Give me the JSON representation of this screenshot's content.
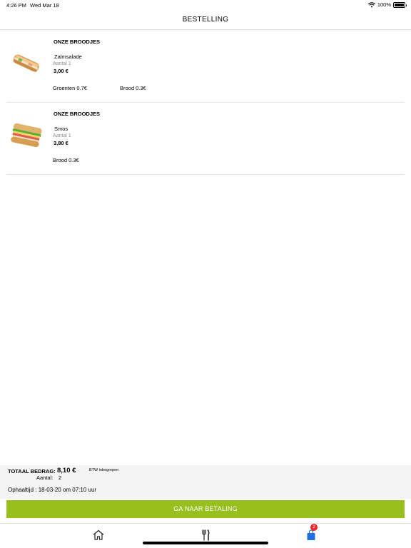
{
  "status_bar": {
    "time": "4:26 PM",
    "date": "Wed Mar 18",
    "battery": "100%",
    "battery_level": 1.0,
    "icons": [
      "wifi-icon",
      "battery-icon"
    ]
  },
  "header": {
    "title": "BESTELLING"
  },
  "items": [
    {
      "category": "ONZE BROODJES",
      "name": "Zalmsalade",
      "qty": "Aantal 1",
      "price": "3,00 €",
      "extras": [
        "Groenten  0.7€",
        "Brood  0.3€"
      ],
      "image": "salmon-baguette-image"
    },
    {
      "category": "ONZE BROODJES",
      "name": "Smos",
      "qty": "Aantal 1",
      "price": "3,80 €",
      "extras": [
        "Brood  0.3€"
      ],
      "image": "smos-sandwich-image"
    }
  ],
  "summary": {
    "total_label": "TOTAAL BEDRAG:",
    "total_value": "8,10 €",
    "vat_note": "BTW inbegrepen",
    "count_label": "Aantal:",
    "count_value": "2",
    "pickup": "Ophaaltijd : 18-03-20 om 07:10 uur"
  },
  "pay_button": {
    "label": "GA NAAR BETALING"
  },
  "tab_bar": {
    "tabs": [
      {
        "name": "home",
        "icon": "home-icon"
      },
      {
        "name": "menu",
        "icon": "fork-knife-icon"
      },
      {
        "name": "cart",
        "icon": "shopping-bag-icon",
        "badge": "2"
      }
    ]
  },
  "colors": {
    "accent": "#97c01e",
    "badge": "#e8262b",
    "cart_icon": "#1f6fe0",
    "summary_bg": "#f4f4f4",
    "secondary_text": "#8e8e8e"
  }
}
